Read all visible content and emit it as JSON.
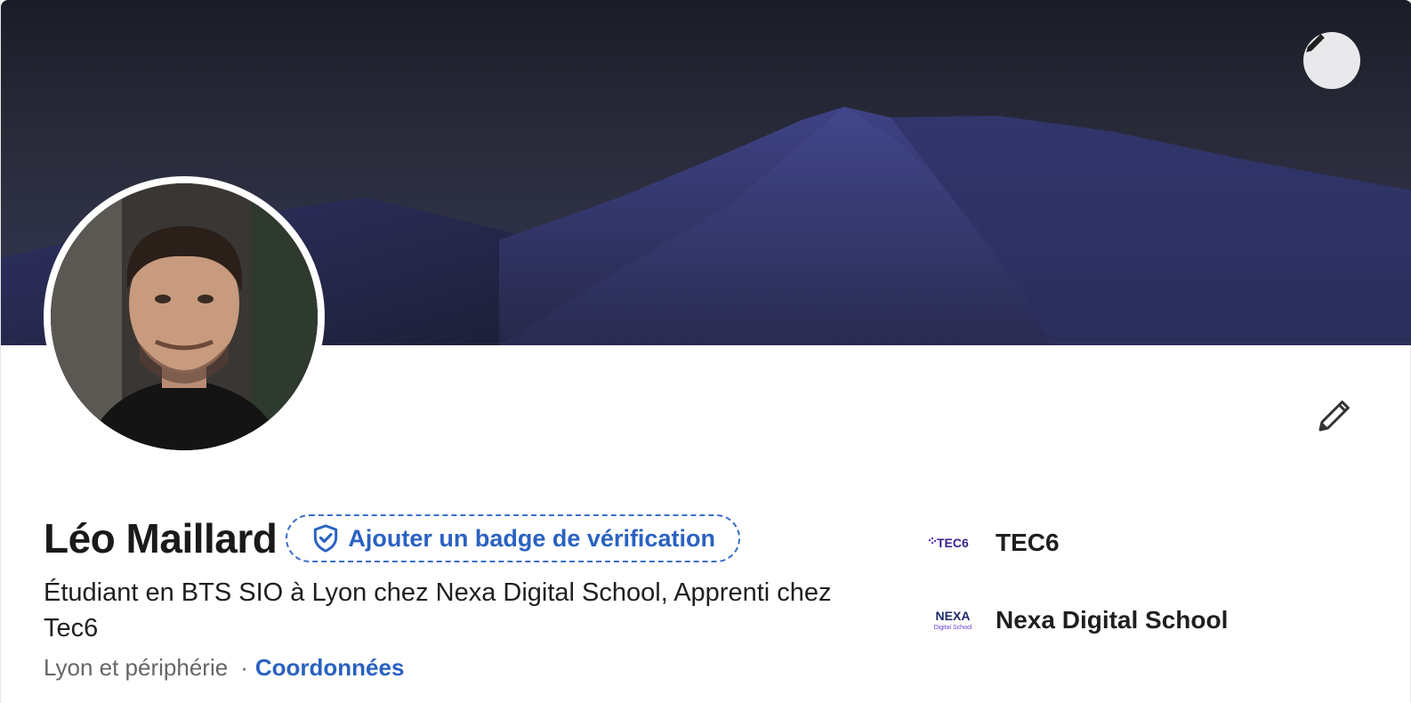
{
  "profile": {
    "name": "Léo Maillard",
    "verify_badge_label": "Ajouter un badge de vérification",
    "headline": "Étudiant en BTS SIO à Lyon chez Nexa Digital School, Apprenti chez Tec6",
    "location": "Lyon et périphérie",
    "separator": "·",
    "contact_label": "Coordonnées"
  },
  "organizations": [
    {
      "name": "TEC6",
      "logo_text": "TEC6",
      "icon": "tec6-logo"
    },
    {
      "name": "Nexa Digital School",
      "logo_text": "NEXA",
      "logo_subtext": "Digital School",
      "icon": "nexa-logo"
    }
  ],
  "icons": {
    "banner_edit": "pencil-icon",
    "intro_edit": "pencil-icon",
    "verify": "shield-check-icon"
  },
  "colors": {
    "accent": "#2a62c1",
    "banner_top": "#1a1d27",
    "dune": "#3b3f78",
    "muted_text": "#666666"
  }
}
